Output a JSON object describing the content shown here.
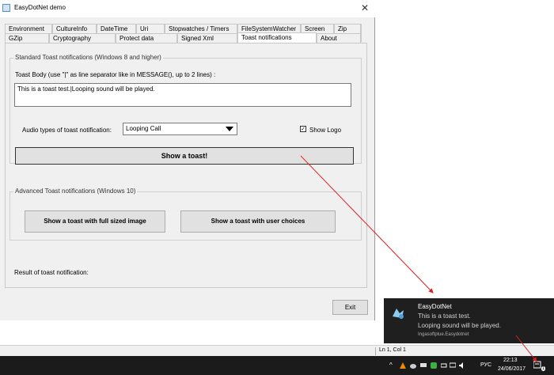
{
  "window": {
    "title": "EasyDotNet demo",
    "close_glyph": "✕"
  },
  "tabs_row1": [
    "Environment",
    "CultureInfo",
    "DateTime",
    "Uri",
    "Stopwatches / Timers",
    "FileSystemWatcher",
    "Screen",
    "Zip"
  ],
  "tabs_row2": [
    "GZip",
    "Cryptography",
    "Protect data",
    "Signed Xml",
    "Toast notifications",
    "About"
  ],
  "active_tab": "Toast notifications",
  "standard": {
    "legend": "Standard Toast notifications (Windows 8 and higher)",
    "body_label": "Toast Body (use \"|\" as line separator like in MESSAGE(), up to 2 lines) :",
    "body_value": "This is a toast test.|Looping sound will be played.",
    "audio_label": "Audio types of toast notification:",
    "audio_value": "Looping Call",
    "show_logo_label": "Show Logo",
    "show_logo_checked": true,
    "show_button": "Show a toast!"
  },
  "advanced": {
    "legend": "Advanced Toast notifications (Windows 10)",
    "full_image_button": "Show a toast with full sized image",
    "choices_button": "Show a toast with user choices"
  },
  "result_label": "Result of toast notification:",
  "exit_button": "Exit",
  "toast": {
    "title": "EasyDotNet",
    "line1": "This is a toast test.",
    "line2": "Looping sound will be played.",
    "source": "Ingasoftplue.Easydotnet"
  },
  "statusbar": {
    "position": "Ln 1, Col 1"
  },
  "taskbar": {
    "language": "РУС",
    "time": "22:13",
    "date": "24/06/2017",
    "notification_badge": "1"
  },
  "colors": {
    "toast_bg": "#1f1f1f",
    "taskbar_bg": "#1b1b1b",
    "arrow": "#e02020",
    "accent": "#4aa3df"
  }
}
